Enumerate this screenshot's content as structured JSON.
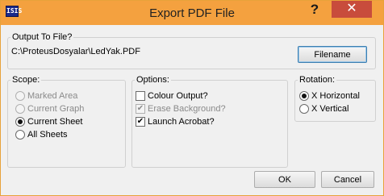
{
  "window": {
    "title": "Export PDF File",
    "app_icon_text": "ISIS",
    "help_label": "?",
    "close_label": "✕"
  },
  "output": {
    "label": "Output To File?",
    "path": "C:\\ProteusDosyalar\\LedYak.PDF",
    "filename_button": "Filename"
  },
  "scope": {
    "label": "Scope:",
    "items": [
      {
        "label": "Marked Area",
        "selected": false,
        "enabled": false
      },
      {
        "label": "Current Graph",
        "selected": false,
        "enabled": false
      },
      {
        "label": "Current Sheet",
        "selected": true,
        "enabled": true
      },
      {
        "label": "All Sheets",
        "selected": false,
        "enabled": true
      }
    ]
  },
  "options": {
    "label": "Options:",
    "items": [
      {
        "label": "Colour Output?",
        "checked": false,
        "enabled": true
      },
      {
        "label": "Erase Background?",
        "checked": true,
        "enabled": false
      },
      {
        "label": "Launch Acrobat?",
        "checked": true,
        "enabled": true
      }
    ]
  },
  "rotation": {
    "label": "Rotation:",
    "items": [
      {
        "label": "X Horizontal",
        "selected": true
      },
      {
        "label": "X Vertical",
        "selected": false
      }
    ]
  },
  "buttons": {
    "ok": "OK",
    "cancel": "Cancel"
  }
}
